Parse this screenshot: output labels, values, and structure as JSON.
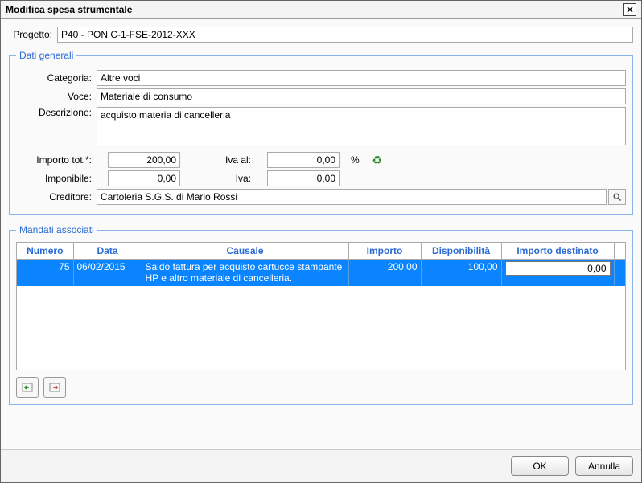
{
  "window": {
    "title": "Modifica spesa strumentale"
  },
  "progetto": {
    "label": "Progetto:",
    "value": "P40 - PON C-1-FSE-2012-XXX"
  },
  "dati_generali": {
    "legend": "Dati generali",
    "categoria": {
      "label": "Categoria:",
      "value": "Altre voci"
    },
    "voce": {
      "label": "Voce:",
      "value": "Materiale di consumo"
    },
    "descrizione": {
      "label": "Descrizione:",
      "value": "acquisto materia di cancelleria"
    },
    "importo_tot": {
      "label": "Importo tot.*:",
      "value": "200,00"
    },
    "iva_al": {
      "label": "Iva al:",
      "value": "0,00",
      "suffix": "%"
    },
    "imponibile": {
      "label": "Imponibile:",
      "value": "0,00"
    },
    "iva": {
      "label": "Iva:",
      "value": "0,00"
    },
    "creditore": {
      "label": "Creditore:",
      "value": "Cartoleria S.G.S. di Mario Rossi"
    }
  },
  "mandati": {
    "legend": "Mandati associati",
    "headers": {
      "numero": "Numero",
      "data": "Data",
      "causale": "Causale",
      "importo": "Importo",
      "disponibilita": "Disponibilità",
      "importo_destinato": "Importo destinato"
    },
    "rows": [
      {
        "numero": "75",
        "data": "06/02/2015",
        "causale": "Saldo fattura per acquisto cartucce stampante HP e altro materiale di cancelleria.",
        "importo": "200,00",
        "disponibilita": "100,00",
        "importo_destinato": "0,00"
      }
    ]
  },
  "footer": {
    "ok": "OK",
    "annulla": "Annulla"
  }
}
